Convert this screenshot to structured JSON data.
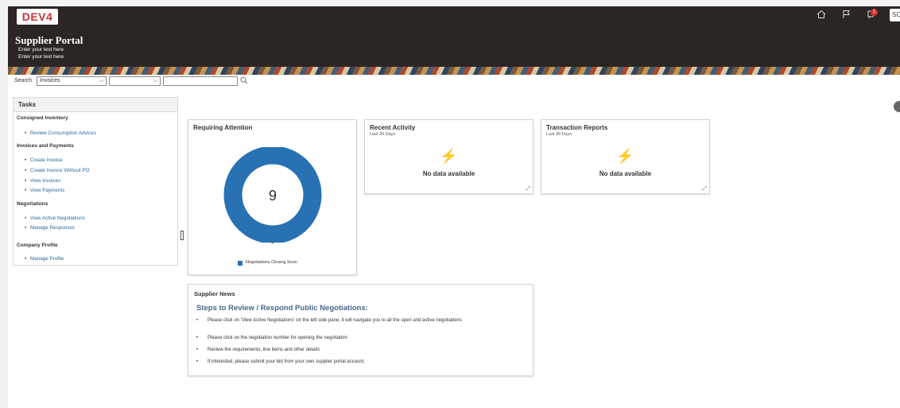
{
  "header": {
    "env_badge": "DEV4",
    "title": "Supplier Portal",
    "subtitle_lines": [
      "Enter your text here",
      "Enter your text here"
    ],
    "notification_count": "1",
    "user_initials": "SC",
    "icons": [
      "home-icon",
      "flag-icon",
      "notifications-icon"
    ],
    "colors": {
      "header_bg": "#2b2623",
      "badge_text": "#c6343a"
    }
  },
  "search": {
    "label": "Search",
    "category_value": "Invoices",
    "second_select_value": "",
    "input_value": ""
  },
  "tasks": {
    "title": "Tasks",
    "sections": [
      {
        "name": "Consigned Inventory",
        "links": [
          "Review Consumption Advices"
        ]
      },
      {
        "name": "Invoices and Payments",
        "links": [
          "Create Invoice",
          "Create Invoice Without PO",
          "View Invoices",
          "View Payments"
        ]
      },
      {
        "name": "Negotiations",
        "links": [
          "View Active Negotiations",
          "Manage Responses"
        ]
      },
      {
        "name": "Company Profile",
        "links": [
          "Manage Profile"
        ]
      }
    ]
  },
  "requiring_attention": {
    "title": "Requiring Attention",
    "center_value": "9",
    "under_value": "9",
    "legend": "Negotiations Closing Soon",
    "color": "#2872b4"
  },
  "recent_activity": {
    "title": "Recent Activity",
    "subtitle": "Last 30 Days",
    "empty_text": "No data available"
  },
  "transaction_reports": {
    "title": "Transaction Reports",
    "subtitle": "Last 30 Days",
    "empty_text": "No data available"
  },
  "supplier_news": {
    "title": "Supplier News",
    "heading": "Steps to Review / Respond Public Negotiations:",
    "items": [
      "Please click on 'View Active Negotiations' on the left side pane, it will navigate you to all the open and active negotiations",
      "Please click on the negotiation number for opening the negotiation",
      "Review the requirements, line items and other details",
      "If interested, please submit your bid from your own supplier portal account."
    ]
  }
}
